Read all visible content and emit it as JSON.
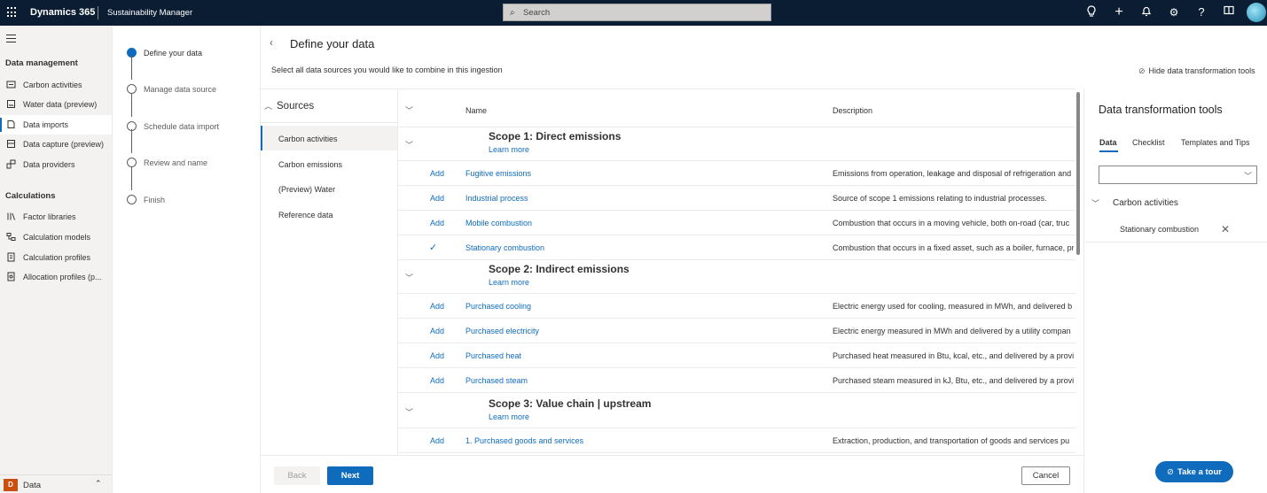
{
  "topbar": {
    "brand": "Dynamics 365",
    "app_name": "Sustainability Manager",
    "search_placeholder": "Search"
  },
  "leftnav": {
    "section1": "Data management",
    "items1": [
      "Carbon activities",
      "Water data (preview)",
      "Data imports",
      "Data capture (preview)",
      "Data providers"
    ],
    "section2": "Calculations",
    "items2": [
      "Factor libraries",
      "Calculation models",
      "Calculation profiles",
      "Allocation profiles (p..."
    ],
    "active_item": "Data imports",
    "area_badge": "D",
    "area_label": "Data"
  },
  "stepper": {
    "steps": [
      "Define your data",
      "Manage data source",
      "Schedule data import",
      "Review and name",
      "Finish"
    ],
    "current": "Define your data"
  },
  "main": {
    "title": "Define your data",
    "subtitle": "Select all data sources you would like to combine in this ingestion",
    "hide_tools": "Hide data transformation tools"
  },
  "sources": {
    "header": "Sources",
    "items": [
      "Carbon activities",
      "Carbon emissions",
      "(Preview) Water",
      "Reference data"
    ],
    "active": "Carbon activities"
  },
  "table": {
    "col_name": "Name",
    "col_description": "Description",
    "learn_more": "Learn more",
    "add_label": "Add",
    "groups": [
      {
        "title": "Scope 1: Direct emissions",
        "rows": [
          {
            "action": "Add",
            "name": "Fugitive emissions",
            "desc": "Emissions from operation, leakage and disposal of refrigeration and"
          },
          {
            "action": "Add",
            "name": "Industrial process",
            "desc": "Source of scope 1 emissions relating to industrial processes."
          },
          {
            "action": "Add",
            "name": "Mobile combustion",
            "desc": "Combustion that occurs in a moving vehicle, both on-road (car, truc"
          },
          {
            "action": "added",
            "name": "Stationary combustion",
            "desc": "Combustion that occurs in a fixed asset, such as a boiler, furnace, pr"
          }
        ]
      },
      {
        "title": "Scope 2: Indirect emissions",
        "rows": [
          {
            "action": "Add",
            "name": "Purchased cooling",
            "desc": "Electric energy used for cooling, measured in MWh, and delivered b"
          },
          {
            "action": "Add",
            "name": "Purchased electricity",
            "desc": "Electric energy measured in MWh and delivered by a utility compan"
          },
          {
            "action": "Add",
            "name": "Purchased heat",
            "desc": "Purchased heat measured in Btu, kcal, etc., and delivered by a provic"
          },
          {
            "action": "Add",
            "name": "Purchased steam",
            "desc": "Purchased steam measured in kJ, Btu, etc., and delivered by a provic"
          }
        ]
      },
      {
        "title": "Scope 3: Value chain | upstream",
        "rows": [
          {
            "action": "Add",
            "name": "1. Purchased goods and services",
            "desc": "Extraction, production, and transportation of goods and services pu"
          }
        ]
      }
    ]
  },
  "footer": {
    "back": "Back",
    "next": "Next",
    "cancel": "Cancel"
  },
  "rpanel": {
    "title": "Data transformation tools",
    "tabs": [
      "Data",
      "Checklist",
      "Templates and Tips"
    ],
    "active_tab": "Data",
    "group": "Carbon activities",
    "item": "Stationary combustion"
  },
  "tour": "Take a tour",
  "colors": {
    "topbar": "#0b1d33",
    "accent": "#0f6cbd"
  }
}
